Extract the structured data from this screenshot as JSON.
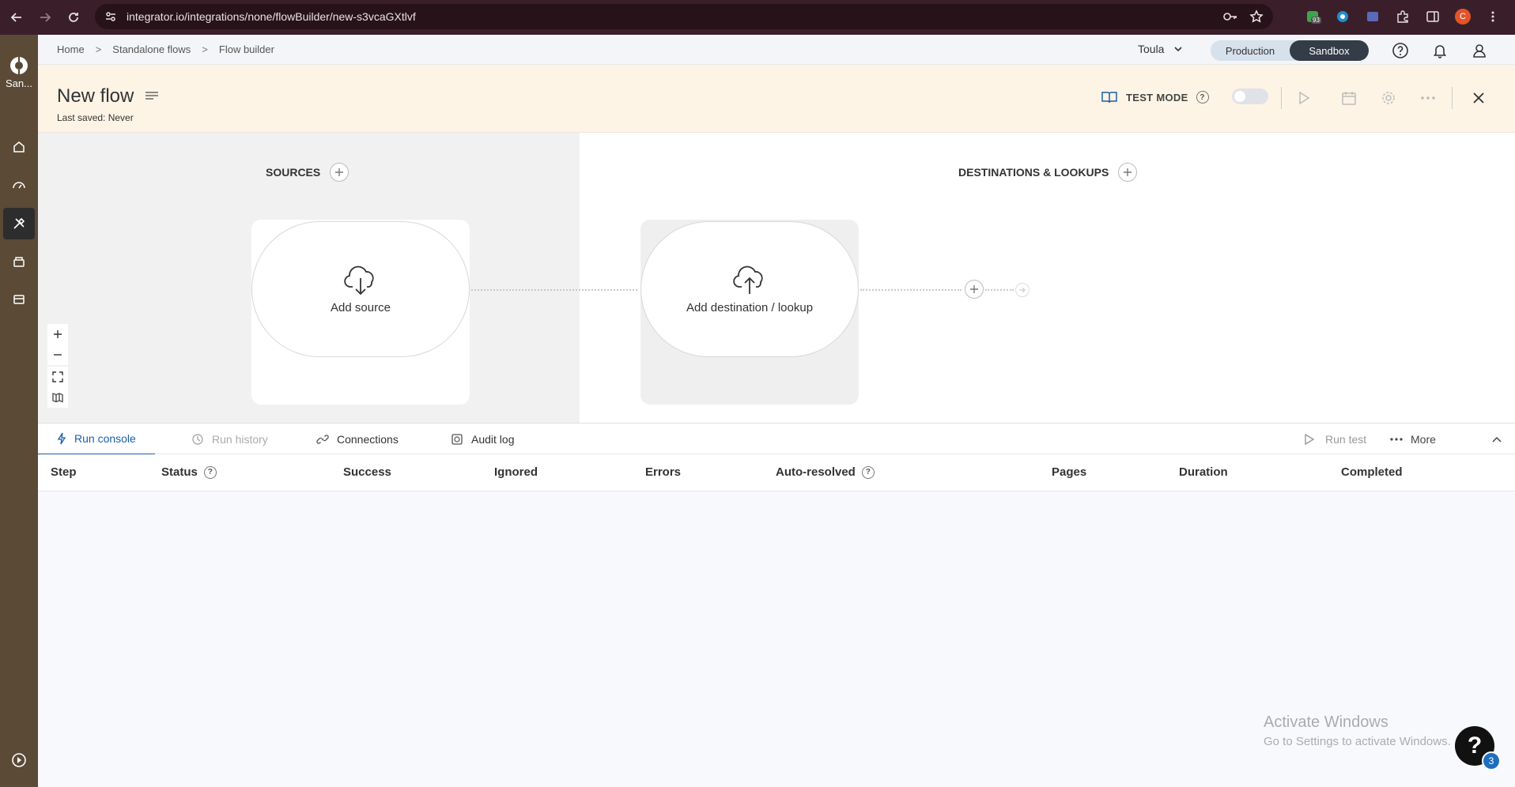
{
  "browser": {
    "url": "integrator.io/integrations/none/flowBuilder/new-s3vcaGXtlvf",
    "ext_badge": "93",
    "profile_initial": "C"
  },
  "rail": {
    "logo_label": "San..."
  },
  "breadcrumb": {
    "items": [
      "Home",
      "Standalone flows",
      "Flow builder"
    ],
    "separator": ">"
  },
  "account": {
    "name": "Toula"
  },
  "environment": {
    "options": [
      "Production",
      "Sandbox"
    ],
    "selected": "Sandbox"
  },
  "flow": {
    "title": "New flow",
    "last_saved": "Last saved: Never",
    "test_mode_label": "TEST MODE"
  },
  "canvas": {
    "sources_title": "SOURCES",
    "destinations_title": "DESTINATIONS & LOOKUPS",
    "add_source_label": "Add source",
    "add_destination_label": "Add destination / lookup"
  },
  "panel": {
    "tabs": [
      {
        "label": "Run console",
        "active": true
      },
      {
        "label": "Run history",
        "active": false
      },
      {
        "label": "Connections",
        "active": false
      },
      {
        "label": "Audit log",
        "active": false
      }
    ],
    "run_test_label": "Run test",
    "more_label": "More"
  },
  "table": {
    "columns": [
      "Step",
      "Status",
      "Success",
      "Ignored",
      "Errors",
      "Auto-resolved",
      "Pages",
      "Duration",
      "Completed"
    ],
    "rows": []
  },
  "watermark": {
    "line1": "Activate Windows",
    "line2": "Go to Settings to activate Windows."
  },
  "help": {
    "badge_count": "3"
  },
  "colors": {
    "chrome_bg": "#3a1f2b",
    "rail_bg": "#5a4a36",
    "header_bg": "#fdf4e6",
    "accent": "#1b5fa6",
    "sandbox_active": "#333c47"
  }
}
